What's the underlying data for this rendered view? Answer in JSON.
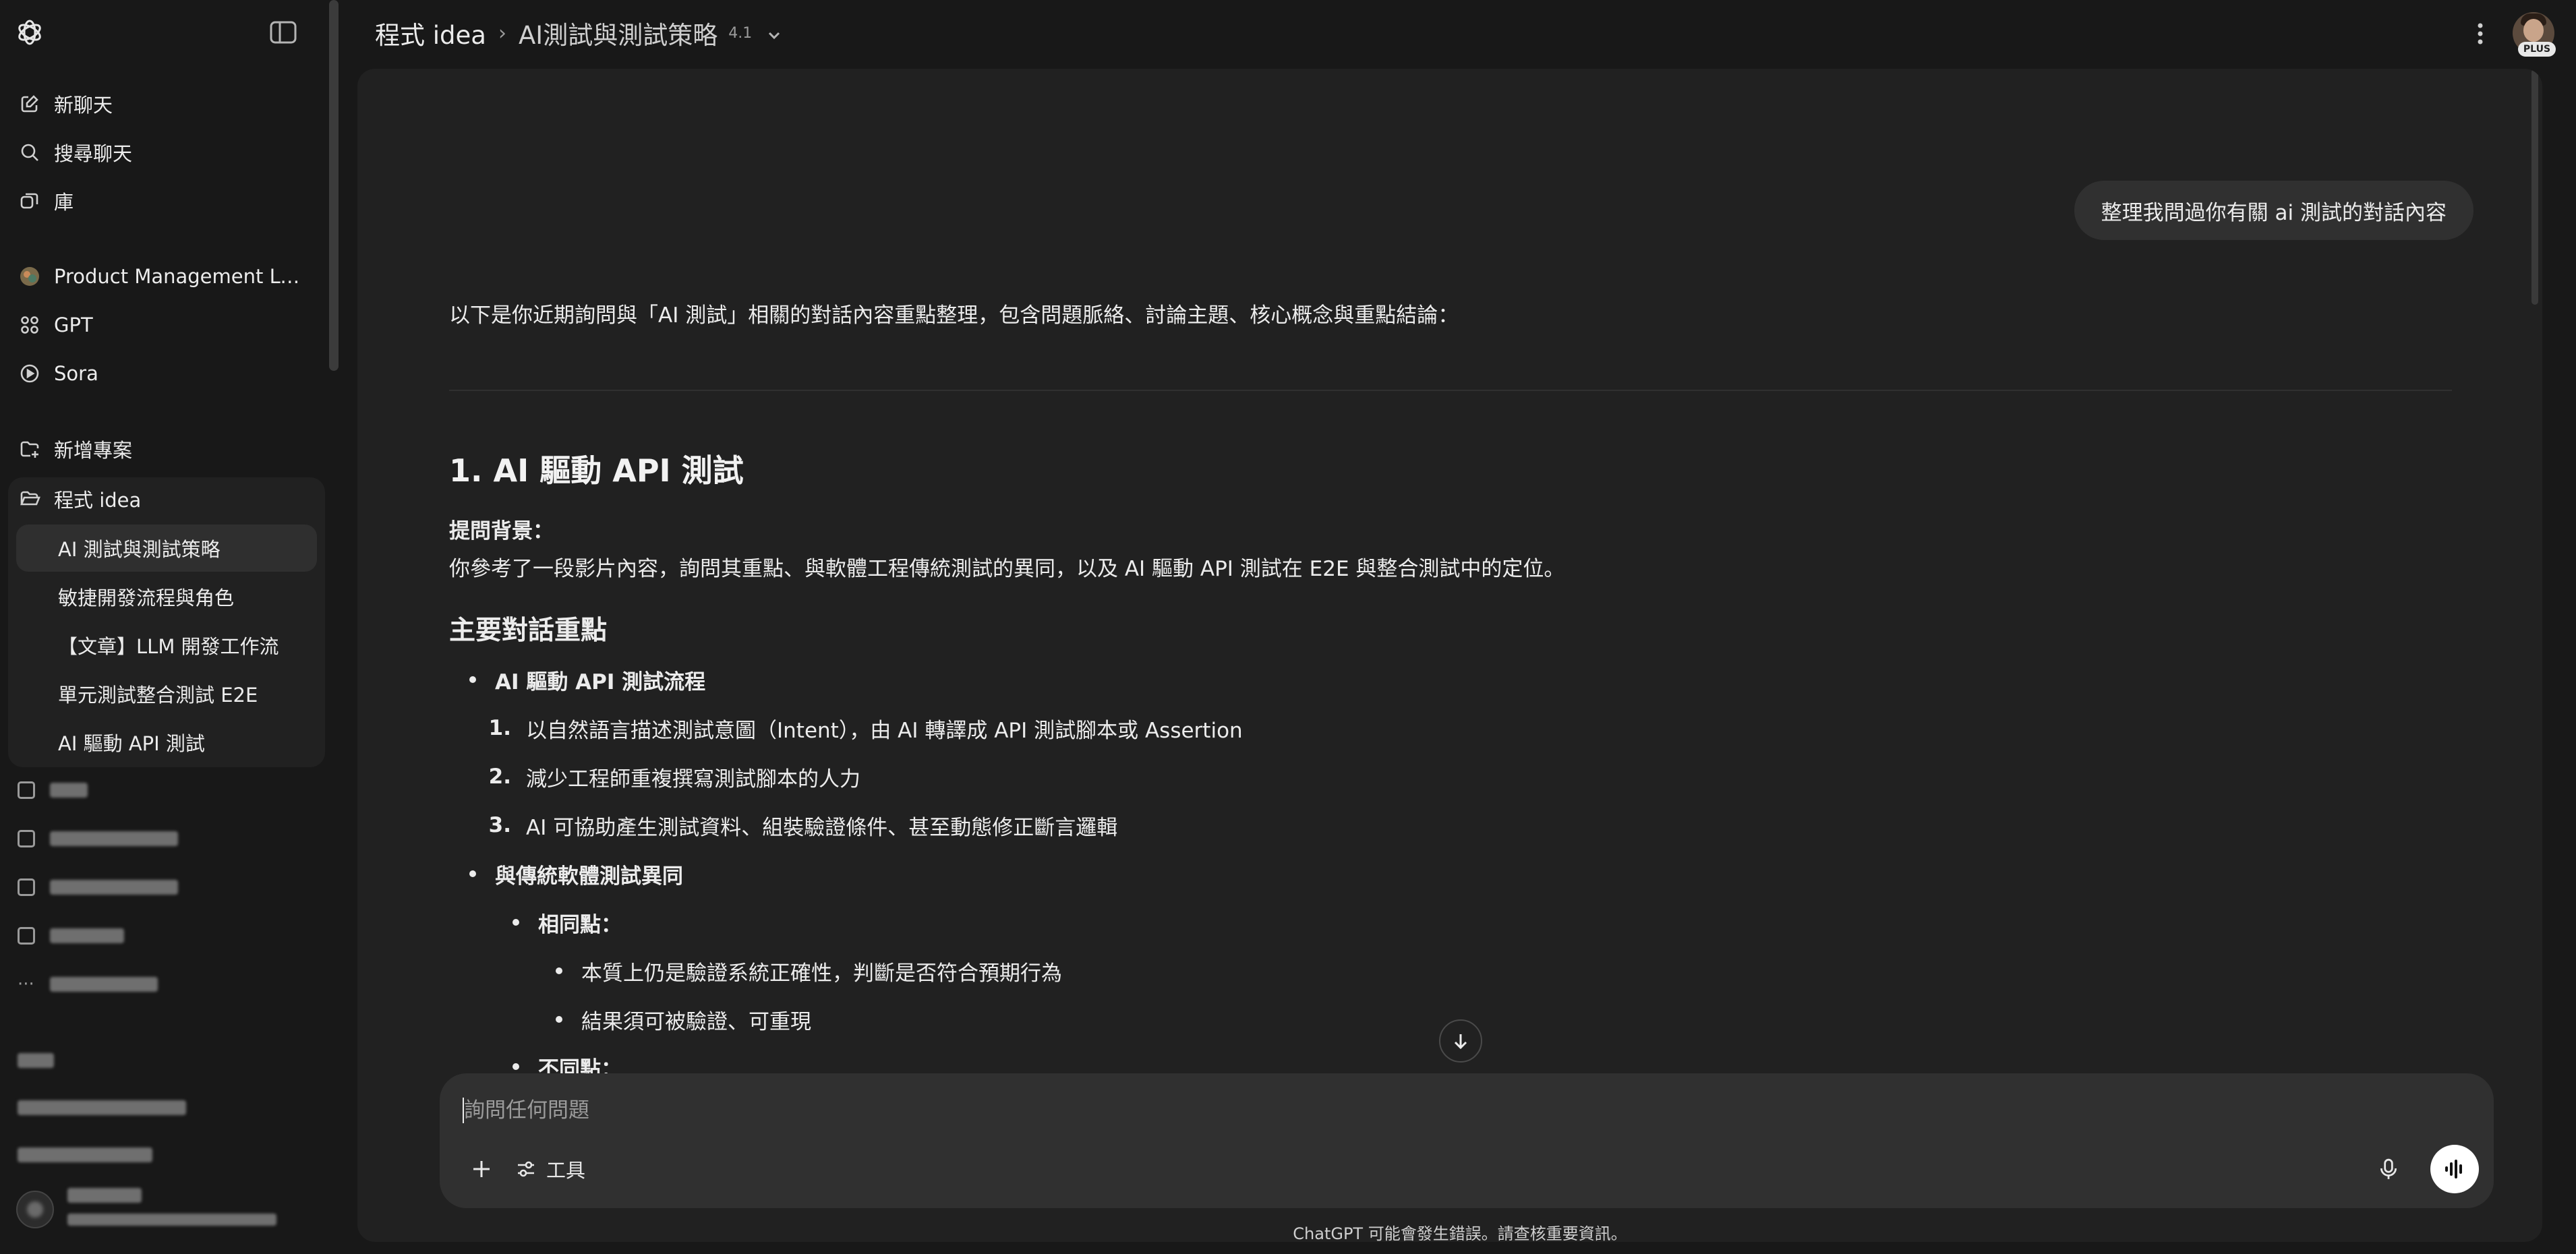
{
  "sidebar": {
    "new_chat": "新聊天",
    "search_chats": "搜尋聊天",
    "library": "庫",
    "product_project": "Product Management Lo...",
    "gpt": "GPT",
    "sora": "Sora",
    "new_project": "新增專案",
    "project": {
      "name": "程式 idea",
      "chats": [
        "AI 測試與測試策略",
        "敏捷開發流程與角色",
        "【文章】LLM 開發工作流",
        "單元測試整合測試 E2E",
        "AI 驅動 API 測試"
      ]
    }
  },
  "header": {
    "project": "程式 idea",
    "chat_title": "AI測試與測試策略",
    "model_version": "4.1",
    "plan_badge": "PLUS"
  },
  "conversation": {
    "user_message": "整理我問過你有關 ai 測試的對話內容",
    "intro": "以下是你近期詢問與「AI 測試」相關的對話內容重點整理，包含問題脈絡、討論主題、核心概念與重點結論：",
    "section1_title": "1. AI 驅動 API 測試",
    "background_label": "提問背景：",
    "background_text": "你參考了一段影片內容，詢問其重點、與軟體工程傳統測試的異同，以及 AI 驅動 API 測試在 E2E 與整合測試中的定位。",
    "key_points_title": "主要對話重點",
    "bullet1": "AI 驅動 API 測試流程",
    "steps": [
      {
        "num": "1.",
        "text": "以自然語言描述測試意圖（Intent），由 AI 轉譯成 API 測試腳本或 Assertion"
      },
      {
        "num": "2.",
        "text": "減少工程師重複撰寫測試腳本的人力"
      },
      {
        "num": "3.",
        "text": "AI 可協助產生測試資料、組裝驗證條件、甚至動態修正斷言邏輯"
      }
    ],
    "bullet2": "與傳統軟體測試異同",
    "similarities_label": "相同點：",
    "similarities": [
      "本質上仍是驗證系統正確性，判斷是否符合預期行為",
      "結果須可被驗證、可重現"
    ],
    "differences_label": "不同點："
  },
  "composer": {
    "placeholder": "詢問任何問題",
    "tools_label": "工具"
  },
  "footer": {
    "disclaimer": "ChatGPT 可能會發生錯誤。請查核重要資訊。"
  },
  "icons": {
    "logo": "openai-logo-icon",
    "sidebar_toggle": "sidebar-toggle-icon",
    "new_chat": "edit-icon",
    "search": "search-icon",
    "library": "library-icon",
    "gpt": "grid-icon",
    "sora": "play-circle-icon",
    "new_project": "folder-plus-icon",
    "project": "folder-open-icon",
    "more": "kebab-icon",
    "scroll_down": "arrow-down-icon",
    "plus": "plus-icon",
    "tools": "sliders-icon",
    "mic": "mic-icon",
    "voice": "voice-waveform-icon"
  }
}
